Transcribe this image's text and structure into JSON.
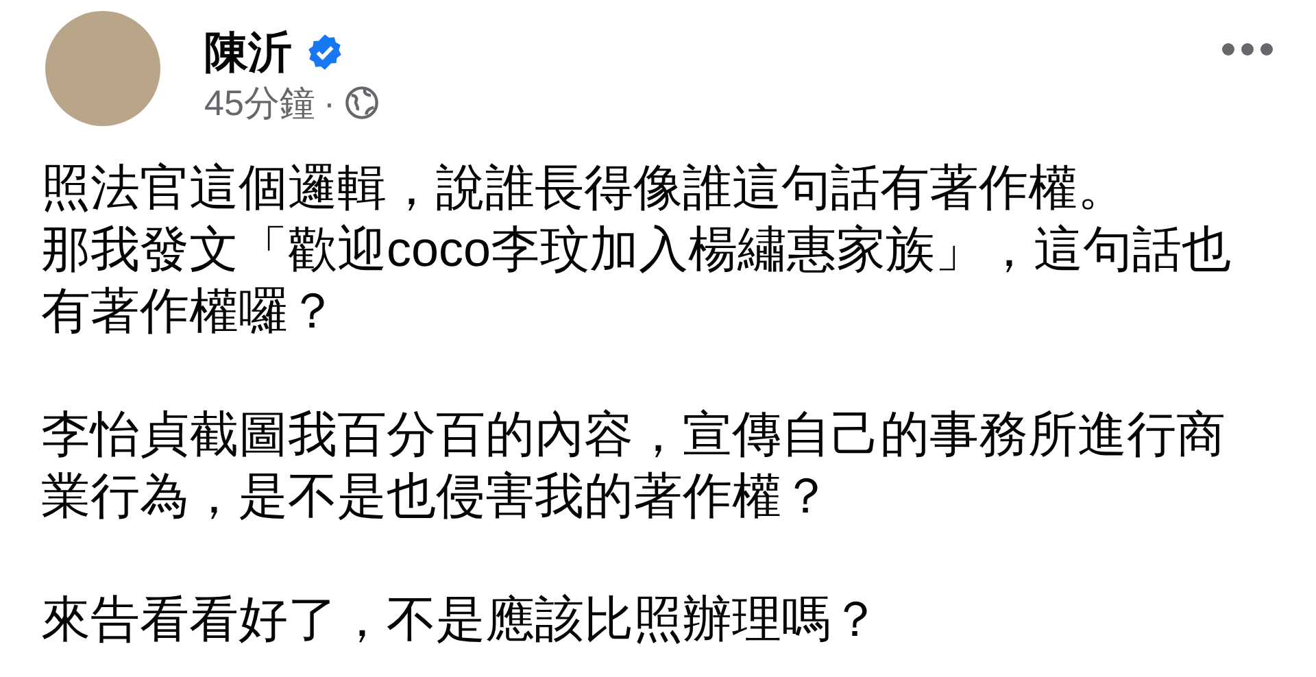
{
  "post": {
    "author": "陳沂",
    "verified": true,
    "time": "45分鐘",
    "separator": "·",
    "paragraphs": [
      [
        "照法官這個邏輯，說誰長得像誰這句話有著作權。",
        "那我發文「歡迎coco李玟加入楊繡惠家族」，這句話也有著作權囉？"
      ],
      [
        "李怡貞截圖我百分百的內容，宣傳自己的事務所進行商業行為，是不是也侵害我的著作權？"
      ],
      [
        "來告看看好了，不是應該比照辦理嗎？"
      ]
    ]
  }
}
